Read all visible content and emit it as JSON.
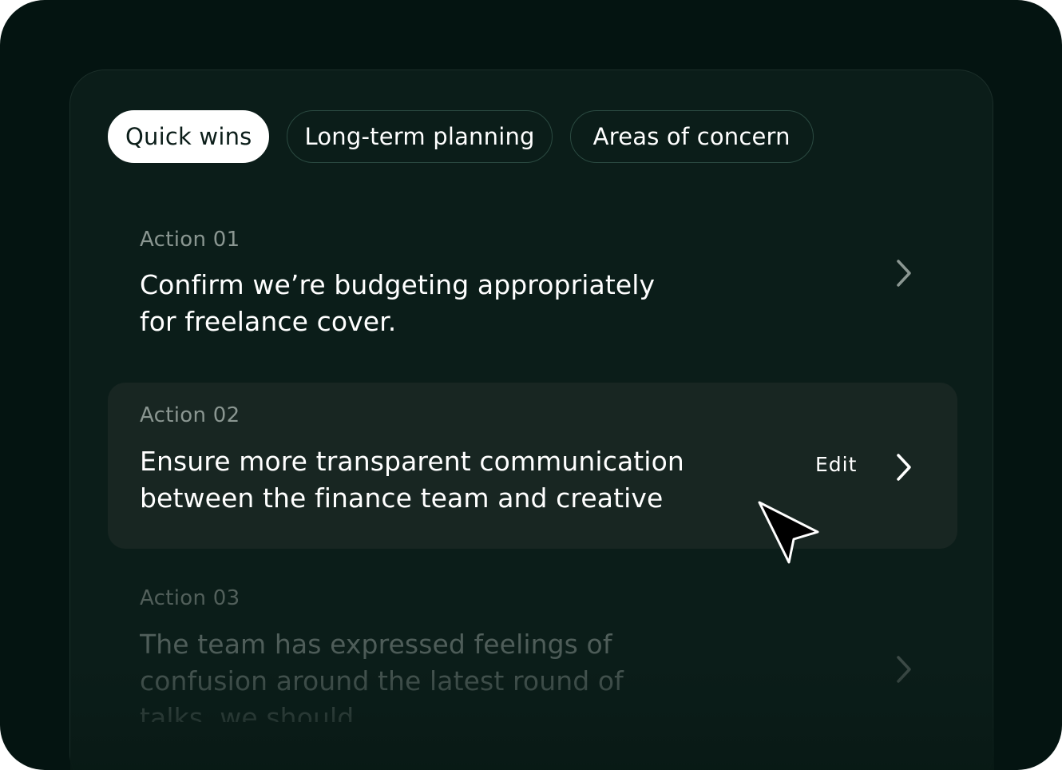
{
  "tabs": [
    {
      "label": "Quick wins",
      "active": true
    },
    {
      "label": "Long-term planning",
      "active": false
    },
    {
      "label": "Areas of concern",
      "active": false
    }
  ],
  "actions": [
    {
      "label": "Action 01",
      "text": "Confirm we’re budgeting appropriately for freelance cover."
    },
    {
      "label": "Action 02",
      "text": "Ensure more transparent communication between the finance team and creative",
      "edit_label": "Edit"
    },
    {
      "label": "Action 03",
      "text": "The team has expressed feelings of confusion around the latest round of talks, we should"
    }
  ],
  "icons": {
    "chevron": "chevron-right-icon",
    "cursor": "mouse-pointer-icon"
  },
  "colors": {
    "background": "#041411",
    "panel": "#0b1d19",
    "highlight_row": "#182622",
    "tab_border": "#2b4a41",
    "active_tab": "#ffffff"
  }
}
